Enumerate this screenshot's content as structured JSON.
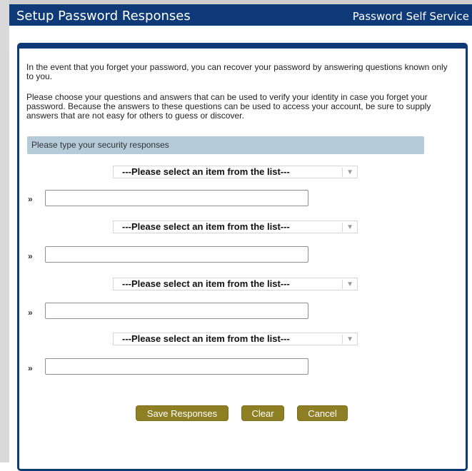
{
  "header": {
    "title": "Setup Password Responses",
    "right_label": "Password Self Service"
  },
  "intro": {
    "paragraph1": "In the event that you forget your password, you can recover your password by answering questions known only to you.",
    "paragraph2": "Please choose your questions and answers that can be used to verify your identity in case you forget your password. Because the answers to these questions can be used to access your account, be sure to supply answers that are not easy for others to guess or discover."
  },
  "section": {
    "label": "Please type your security responses"
  },
  "questions": [
    {
      "select_value": "---Please select an item from the list---",
      "bullet": "»",
      "answer": ""
    },
    {
      "select_value": "---Please select an item from the list---",
      "bullet": "»",
      "answer": ""
    },
    {
      "select_value": "---Please select an item from the list---",
      "bullet": "»",
      "answer": ""
    },
    {
      "select_value": "---Please select an item from the list---",
      "bullet": "»",
      "answer": ""
    }
  ],
  "buttons": {
    "save": "Save Responses",
    "clear": "Clear",
    "cancel": "Cancel"
  },
  "colors": {
    "header_bg": "#0e3a78",
    "section_bg": "#b5cbd9",
    "button_bg": "#8e7f25"
  }
}
